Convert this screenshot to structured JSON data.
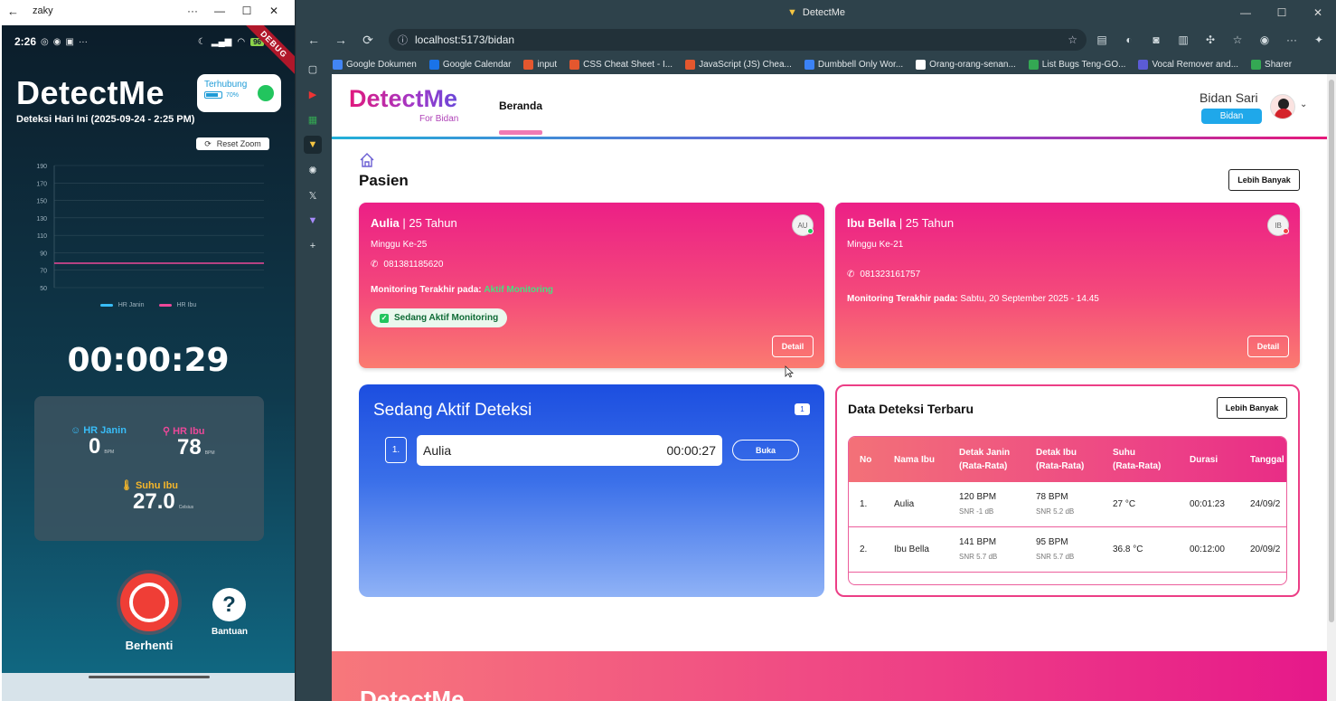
{
  "phone_window": {
    "title": "zaky",
    "status_time": "2:26",
    "battery_badge": "96",
    "debug_label": "DEBUG",
    "app_title": "DetectMe",
    "subtitle": "Deteksi Hari Ini (2025-09-24 - 2:25 PM)",
    "connection_label": "Terhubung",
    "battery_pct": "70%",
    "battery_level": 0.7,
    "connection_color": "#22c55e",
    "reset_zoom": "Reset Zoom",
    "chart_legend": [
      "HR Janin",
      "HR Ibu"
    ],
    "timer": "00:00:29",
    "hr_janin_label": "HR Janin",
    "hr_janin_value": "0",
    "hr_janin_unit": "BPM",
    "hr_ibu_label": "HR Ibu",
    "hr_ibu_value": "78",
    "hr_ibu_unit": "BPM",
    "suhu_label": "Suhu Ibu",
    "suhu_value": "27.0",
    "suhu_unit": "Celsius",
    "stop_label": "Berhenti",
    "help_label": "Bantuan"
  },
  "chart_data": {
    "type": "line",
    "title": "",
    "xlabel": "",
    "ylabel": "",
    "ylim": [
      50,
      190
    ],
    "yticks": [
      190,
      170,
      150,
      130,
      110,
      90,
      70,
      50
    ],
    "grid": true,
    "legend_position": "bottom",
    "series": [
      {
        "name": "HR Janin",
        "color": "#38bdf8",
        "values": []
      },
      {
        "name": "HR Ibu",
        "color": "#ec4899",
        "values": [
          78,
          78,
          78,
          78,
          78,
          78,
          78,
          78
        ]
      }
    ]
  },
  "browser": {
    "window_title": "DetectMe",
    "url": "localhost:5173/bidan",
    "bookmarks": [
      {
        "label": "Google Dokumen",
        "color": "#4285f4"
      },
      {
        "label": "Google Calendar",
        "color": "#1a73e8"
      },
      {
        "label": "input",
        "color": "#e4572e"
      },
      {
        "label": "CSS Cheat Sheet - I...",
        "color": "#e4572e"
      },
      {
        "label": "JavaScript (JS) Chea...",
        "color": "#e4572e"
      },
      {
        "label": "Dumbbell Only Wor...",
        "color": "#3b82f6"
      },
      {
        "label": "Orang-orang-senan...",
        "color": "#ffffff"
      },
      {
        "label": "List Bugs Teng-GO...",
        "color": "#34a853"
      },
      {
        "label": "Vocal Remover and...",
        "color": "#5b5bd6"
      },
      {
        "label": "Sharer",
        "color": "#34a853"
      }
    ]
  },
  "web": {
    "brand": "DetectMe",
    "brand_sub": "For Bidan",
    "nav_tab": "Beranda",
    "user_name": "Bidan Sari",
    "user_role": "Bidan",
    "section_title": "Pasien",
    "more_button": "Lebih Banyak",
    "patients": [
      {
        "name": "Aulia",
        "age": "| 25 Tahun",
        "week": "Minggu Ke-25",
        "phone": "081381185620",
        "monitor_label": "Monitoring Terakhir pada:",
        "monitor_value": "Aktif Monitoring",
        "chip": "Sedang Aktif Monitoring",
        "initials": "AU",
        "status_color": "#22c55e",
        "detail": "Detail"
      },
      {
        "name": "Ibu Bella",
        "age": "| 25 Tahun",
        "week": "Minggu Ke-21",
        "phone": "081323161757",
        "monitor_label": "Monitoring Terakhir pada:",
        "monitor_value": "Sabtu, 20 September 2025 - 14.45",
        "initials": "IB",
        "status_color": "#ef4444",
        "detail": "Detail"
      }
    ],
    "active": {
      "title": "Sedang Aktif Deteksi",
      "count": "1",
      "row_no": "1.",
      "row_name": "Aulia",
      "row_duration": "00:00:27",
      "open_label": "Buka"
    },
    "latest": {
      "title": "Data Deteksi Terbaru",
      "more_button": "Lebih Banyak",
      "headers": [
        "No",
        "Nama Ibu",
        "Detak Janin\n(Rata-Rata)",
        "Detak Ibu\n(Rata-Rata)",
        "Suhu\n(Rata-Rata)",
        "Durasi",
        "Tanggal"
      ],
      "rows": [
        {
          "no": "1.",
          "nama": "Aulia",
          "janin": "120 BPM",
          "janin_snr": "SNR -1 dB",
          "ibu": "78 BPM",
          "ibu_snr": "SNR 5.2 dB",
          "suhu": "27 °C",
          "durasi": "00:01:23",
          "tanggal": "24/09/2"
        },
        {
          "no": "2.",
          "nama": "Ibu Bella",
          "janin": "141 BPM",
          "janin_snr": "SNR 5.7 dB",
          "ibu": "95 BPM",
          "ibu_snr": "SNR 5.7 dB",
          "suhu": "36.8 °C",
          "durasi": "00:12:00",
          "tanggal": "20/09/2"
        }
      ]
    },
    "footer_brand": "DetectMe"
  }
}
